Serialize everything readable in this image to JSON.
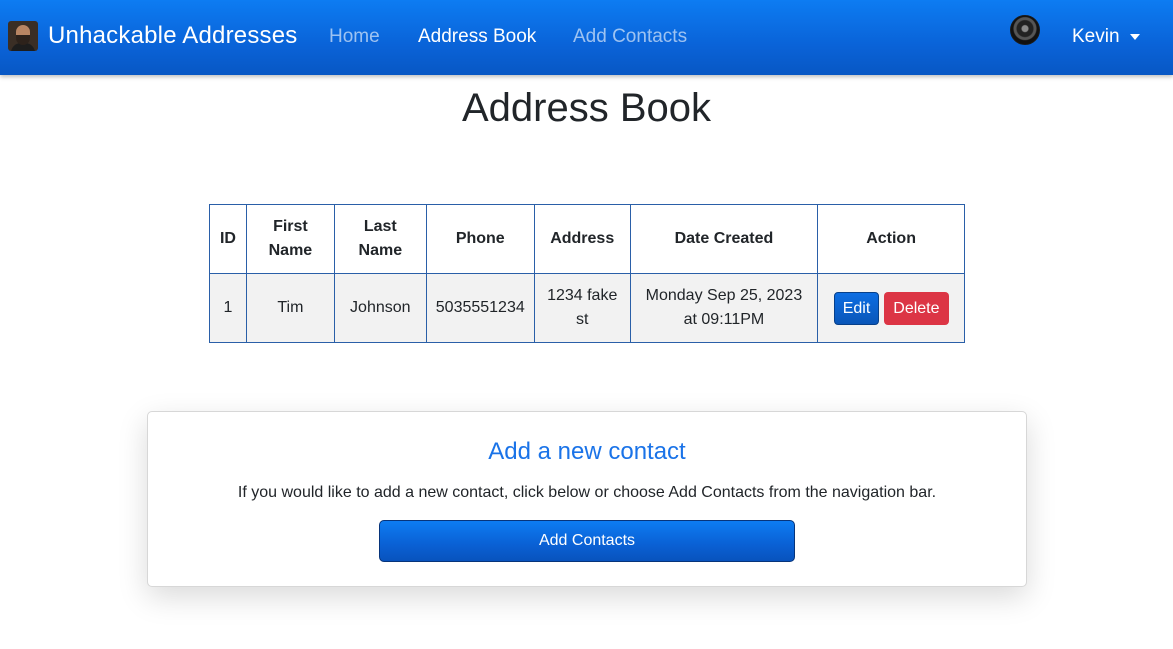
{
  "navbar": {
    "brand": "Unhackable Addresses",
    "links": [
      {
        "label": "Home"
      },
      {
        "label": "Address Book"
      },
      {
        "label": "Add Contacts"
      }
    ],
    "user": {
      "name": "Kevin"
    },
    "colors": {
      "background": "#0a63d8",
      "active": "#ffffff",
      "inactive": "rgba(255,255,255,0.6)"
    }
  },
  "page": {
    "title": "Address Book"
  },
  "table": {
    "headers": {
      "id": "ID",
      "first_name": "First Name",
      "last_name": "Last Name",
      "phone": "Phone",
      "address": "Address",
      "date_created": "Date Created",
      "action": "Action"
    },
    "rows": [
      {
        "id": "1",
        "first_name": "Tim",
        "last_name": "Johnson",
        "phone": "5035551234",
        "address": "1234 fake st",
        "date_created": "Monday Sep 25, 2023 at 09:11PM",
        "edit_label": "Edit",
        "delete_label": "Delete"
      }
    ]
  },
  "card": {
    "title": "Add a new contact",
    "text": "If you would like to add a new contact, click below or choose Add Contacts from the navigation bar.",
    "button_label": "Add Contacts",
    "colors": {
      "title": "#1a73e8",
      "delete": "#dc3545"
    }
  }
}
